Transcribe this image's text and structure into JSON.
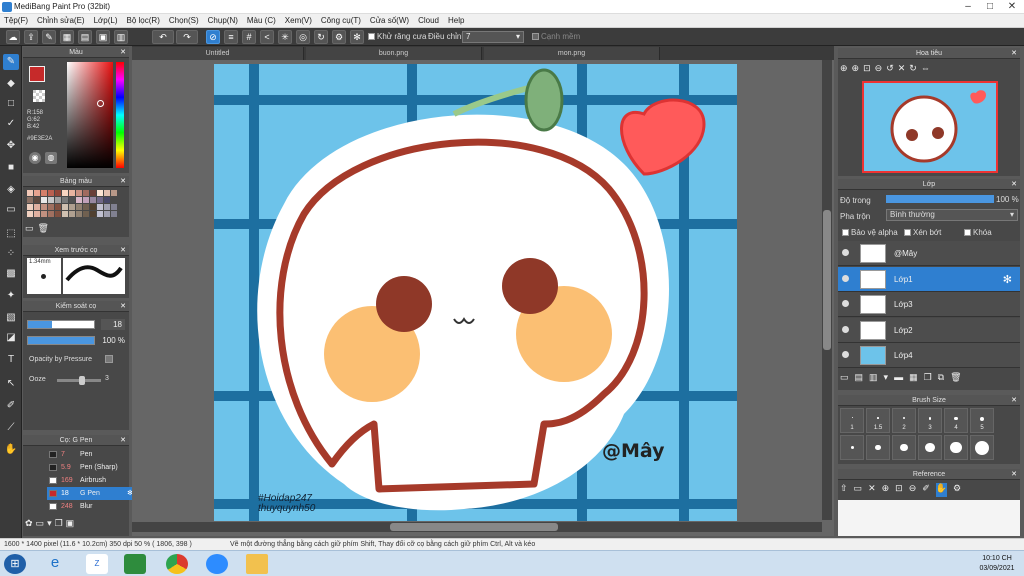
{
  "app": {
    "title": "MediBang Paint Pro (32bit)"
  },
  "menu": [
    "Tệp(F)",
    "Chỉnh sửa(E)",
    "Lớp(L)",
    "Bộ lọc(R)",
    "Chọn(S)",
    "Chụp(N)",
    "Màu (C)",
    "Xem(V)",
    "Công cụ(T)",
    "Cửa số(W)",
    "Cloud",
    "Help"
  ],
  "toolbar": {
    "antialias_label": "Khử răng cưa",
    "adjust_label": "Điều chỉnh",
    "adjust_value": "7",
    "soft_edge_label": "Cạnh mềm"
  },
  "tabs": [
    "Untitled",
    "buon.png",
    "mon.png"
  ],
  "color_panel": {
    "title": "Màu",
    "r": "R:158",
    "g": "G:62",
    "b": "B:42",
    "hex": "#9E3E2A",
    "fg_color": "#cc2a2a"
  },
  "palette_panel": {
    "title": "Bảng màu"
  },
  "preview_panel": {
    "title": "Xem trước cọ",
    "size": "1.34mm"
  },
  "brush_control": {
    "title": "Kiểm soát cọ",
    "size_value": "18",
    "opacity_value": "100 %",
    "pressure_label": "Opacity by Pressure",
    "ooze_label": "Ooze",
    "ooze_value": "3"
  },
  "brush_list": {
    "title": "Cọ: G Pen",
    "items": [
      {
        "size": "7",
        "name": "Pen"
      },
      {
        "size": "5.9",
        "name": "Pen (Sharp)"
      },
      {
        "size": "169",
        "name": "Airbrush"
      },
      {
        "size": "18",
        "name": "G Pen"
      },
      {
        "size": "248",
        "name": "Blur"
      }
    ]
  },
  "navigator": {
    "title": "Hoa tiêu"
  },
  "layer_panel": {
    "title": "Lớp",
    "opacity_label": "Độ trong",
    "opacity_value": "100 %",
    "blend_label": "Pha trộn",
    "blend_value": "Bình thường",
    "protect_alpha": "Bảo vệ alpha",
    "clipping": "Xén bớt",
    "lock": "Khóa",
    "layers": [
      {
        "name": "@Mây"
      },
      {
        "name": "Lớp1"
      },
      {
        "name": "Lớp3"
      },
      {
        "name": "Lớp2"
      },
      {
        "name": "Lớp4"
      }
    ]
  },
  "brush_size_panel": {
    "title": "Brush Size",
    "sizes": [
      "1",
      "1.5",
      "2",
      "3",
      "4",
      "5"
    ]
  },
  "reference_panel": {
    "title": "Reference"
  },
  "artwork": {
    "signature": "@Mây",
    "watermark_line1": "#Hoidap247",
    "watermark_line2": "thuyquynh50"
  },
  "status": {
    "dimensions": "1600 * 1400 pixel   (11.6 * 10.2cm)   350 dpi   50 %   ( 1806, 398 )",
    "hint": "Vẽ một đường thẳng bằng cách giữ phím Shift, Thay đổi cỡ cọ bằng cách giữ phím Ctrl, Alt và kéo"
  },
  "taskbar": {
    "time": "10:10 CH",
    "date": "03/09/2021"
  }
}
